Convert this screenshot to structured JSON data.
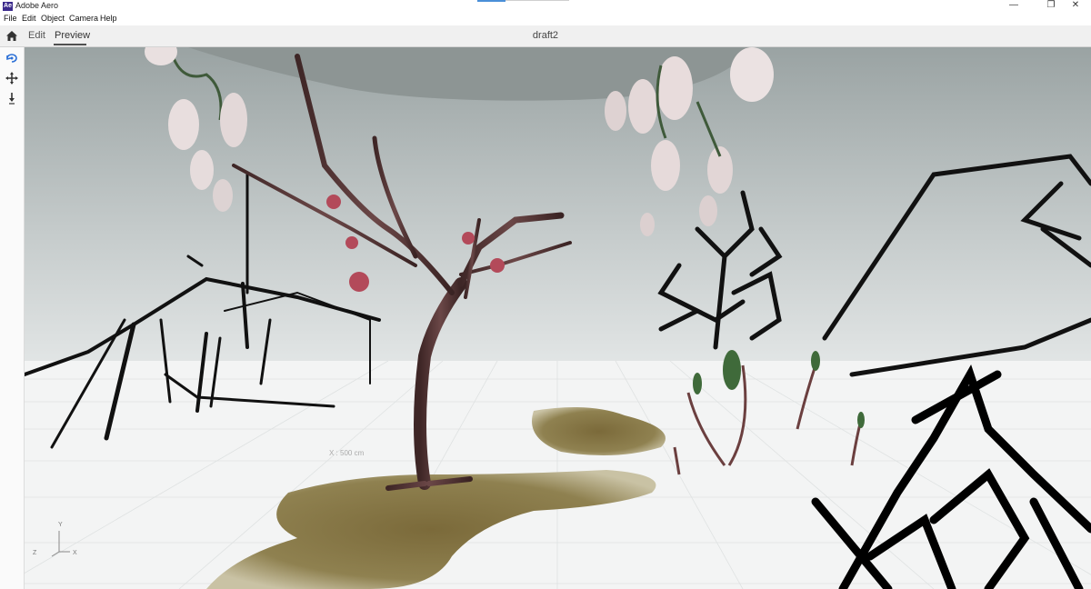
{
  "window": {
    "title": "Adobe Aero",
    "logo_text": "Ae",
    "controls": [
      "—",
      "❐",
      "✕"
    ]
  },
  "menu": {
    "items": [
      "File",
      "Edit",
      "Object",
      "Camera",
      "Help"
    ]
  },
  "toolbar": {
    "tabs": [
      "Edit",
      "Preview"
    ],
    "active_tab": "Preview",
    "document_title": "draft2"
  },
  "left_tools": [
    "orbit-camera-icon",
    "pan-move-icon",
    "drop-down-icon"
  ],
  "viewport": {
    "distance_readout": "X : 500 cm",
    "gizmo": {
      "y": "Y",
      "z": "Z",
      "x": "X"
    }
  },
  "colors": {
    "accent": "#4a8fd8",
    "sky_top": "#a9b2b1",
    "ground": "#f2f3f3",
    "trunk": "#5a3a3a",
    "moss": "#8a7a45"
  }
}
